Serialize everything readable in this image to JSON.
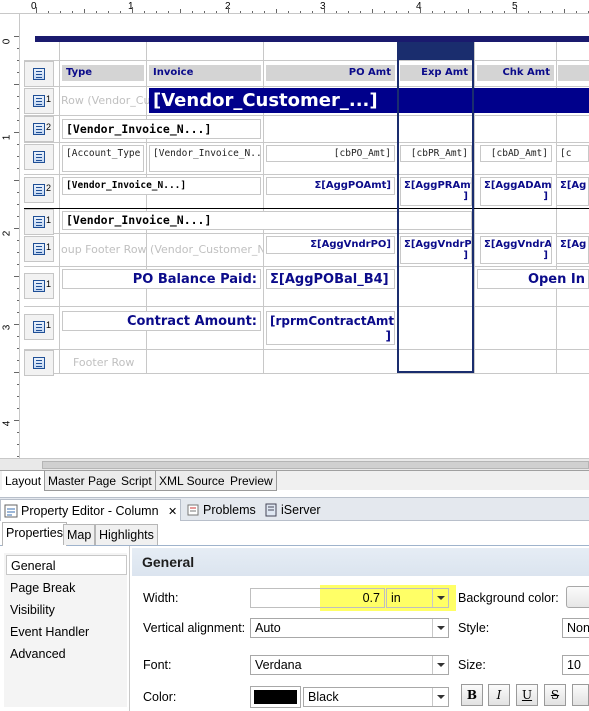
{
  "ruler": {
    "h_numbers": [
      "0",
      "1",
      "2",
      "3",
      "4",
      "5"
    ],
    "v_numbers": [
      "0",
      "1",
      "2",
      "3",
      "4"
    ]
  },
  "headers": [
    "Type",
    "Invoice",
    "PO Amt",
    "Exp Amt",
    "Chk Amt"
  ],
  "rows": {
    "group_header_ghost": "Row (Vendor_Cu",
    "group_header_field": "[Vendor_Customer_...]",
    "invoice_group_field": "[Vendor_Invoice_N...]",
    "detail": [
      "[Account_Type",
      "[Vendor_Invoice_N...",
      "[cbPO_Amt]",
      "[cbPR_Amt]",
      "[cbAD_Amt]",
      "[c"
    ],
    "invoice_footer": [
      "[Vendor_Invoice_N...]",
      "Σ[AggPOAmt]",
      "Σ[AggPRAmt]",
      "Σ[AggADAmt]",
      "Σ[Ag"
    ],
    "invoice_footer_exp_tail": "]",
    "invoice_footer_chk_tail": "]",
    "invoice_footer2": "[Vendor_Invoice_N...]",
    "group_footer_ghost": "oup Footer Row (Vendor_Customer_Nar",
    "group_footer": [
      "Σ[AggVndrPO]",
      "Σ[AggVndrPR",
      "Σ[AggVndrAD",
      "Σ[Ag"
    ],
    "group_footer_exp_tail": "]",
    "group_footer_chk_tail": "]",
    "po_balance_label": "PO Balance Paid:",
    "po_balance_value": "Σ[AggPOBal_B4]",
    "open_label": "Open In",
    "contract_label": "Contract Amount:",
    "contract_value": "[rprmContractAmt",
    "contract_value_tail": "]",
    "footer_ghost": "Footer Row"
  },
  "row_levels": [
    "",
    "1",
    "2",
    "",
    "2",
    "1",
    "1",
    "1",
    "1",
    ""
  ],
  "editor_tabs": [
    "Layout",
    "Master Page",
    "Script",
    "XML Source",
    "Preview"
  ],
  "view_tabs": [
    {
      "label": "Property Editor - Column",
      "close": "✕"
    },
    {
      "label": "Problems"
    },
    {
      "label": "iServer Explorer"
    }
  ],
  "property_tabs": [
    "Properties",
    "Map",
    "Highlights"
  ],
  "categories": [
    "General",
    "Page Break",
    "Visibility",
    "Event Handler",
    "Advanced"
  ],
  "section_title": "General",
  "props": {
    "width_label": "Width:",
    "width_value": "0.7",
    "width_unit": "in",
    "bg_label": "Background color:",
    "valign_label": "Vertical alignment:",
    "valign_value": "Auto",
    "style_label": "Style:",
    "style_value": "Non",
    "font_label": "Font:",
    "font_value": "Verdana",
    "size_label": "Size:",
    "size_value": "10",
    "color_label": "Color:",
    "color_value": "Black",
    "color_swatch": "#000000",
    "fmt_buttons": [
      "B",
      "I",
      "U",
      "S"
    ]
  },
  "colors": {
    "highlight": "#ffff66",
    "selection": "#1a2d6e",
    "header_text": "#0b0b8a"
  }
}
